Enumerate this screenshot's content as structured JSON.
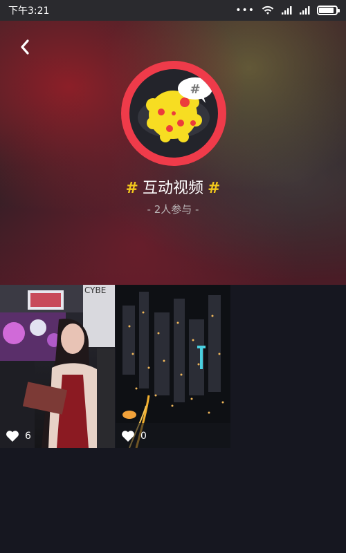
{
  "status_bar": {
    "time": "下午3:21",
    "dots": "•••",
    "icons": [
      "wifi-icon",
      "signal-icon",
      "signal-icon",
      "battery-icon"
    ]
  },
  "header": {
    "back_icon": "back-chevron-icon",
    "topic_hash_left": "#",
    "topic_name": "互动视频",
    "topic_hash_right": "#",
    "participants": "- 2人参与 -",
    "avatar_icon": "cheese-planet-icon",
    "badge_icon": "hashtag-bubble-icon"
  },
  "videos": [
    {
      "likes": "6",
      "like_icon": "heart-icon",
      "subject": "girl-in-red-dress-at-night-street"
    },
    {
      "likes": "0",
      "like_icon": "heart-icon",
      "subject": "city-night-aerial"
    }
  ],
  "colors": {
    "background": "#161720",
    "accent_red": "#ef3b4a",
    "hash_yellow": "#f2c81c"
  }
}
